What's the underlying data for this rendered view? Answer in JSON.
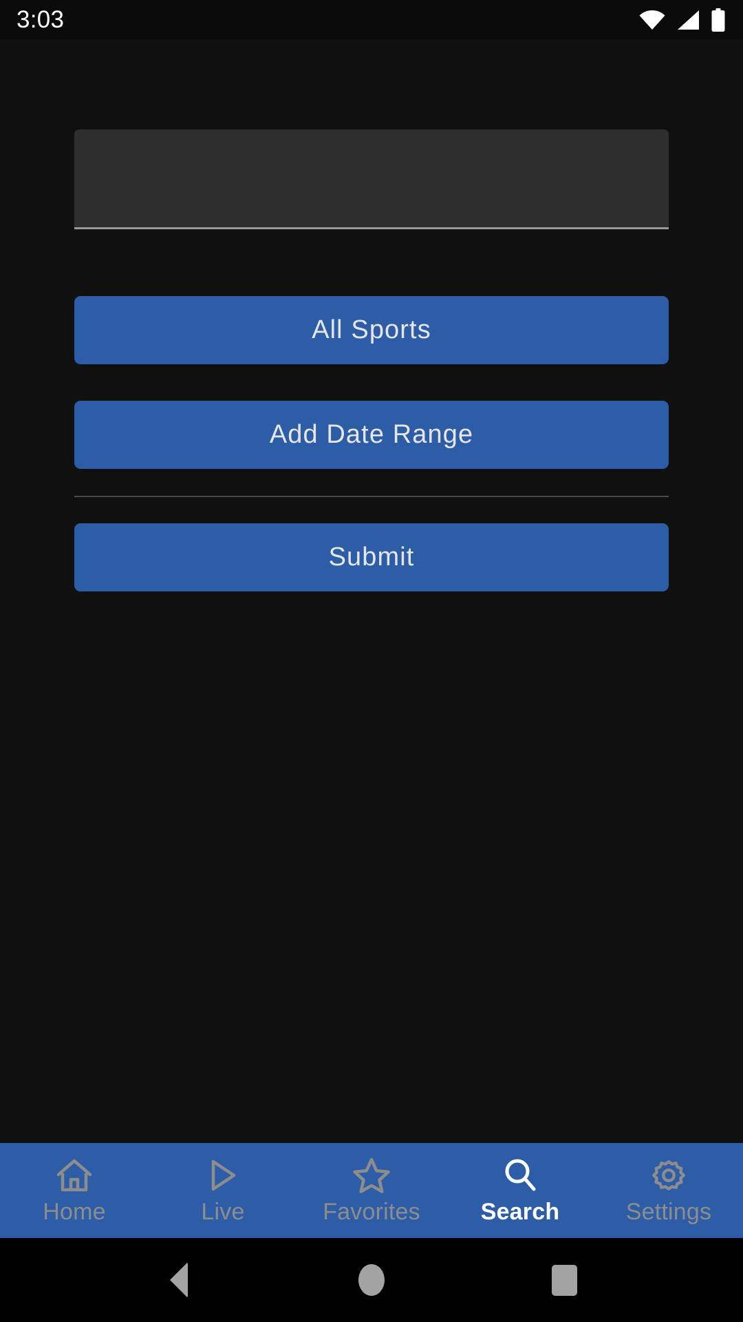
{
  "status_bar": {
    "clock": "3:03",
    "icons": [
      "wifi-icon",
      "cellular-signal-icon",
      "battery-icon"
    ]
  },
  "search_form": {
    "query_value": "",
    "query_placeholder": "",
    "sport_filter_label": "All Sports",
    "date_range_label": "Add Date Range",
    "submit_label": "Submit"
  },
  "tab_bar": {
    "active": "Search",
    "items": [
      {
        "label": "Home",
        "icon": "home-icon",
        "active": false
      },
      {
        "label": "Live",
        "icon": "play-icon",
        "active": false
      },
      {
        "label": "Favorites",
        "icon": "star-icon",
        "active": false
      },
      {
        "label": "Search",
        "icon": "search-icon",
        "active": true
      },
      {
        "label": "Settings",
        "icon": "gear-icon",
        "active": false
      }
    ]
  },
  "system_nav": {
    "back": "back-button",
    "home": "home-button",
    "recents": "recents-button"
  },
  "colors": {
    "background": "#101010",
    "accent_blue": "#2d5da6",
    "field_fill": "#2e2e2e",
    "field_underline": "#9a9a9a",
    "inactive_tab": "#8d8d8d",
    "active_tab": "#ffffff",
    "divider": "#4a4a4a"
  }
}
